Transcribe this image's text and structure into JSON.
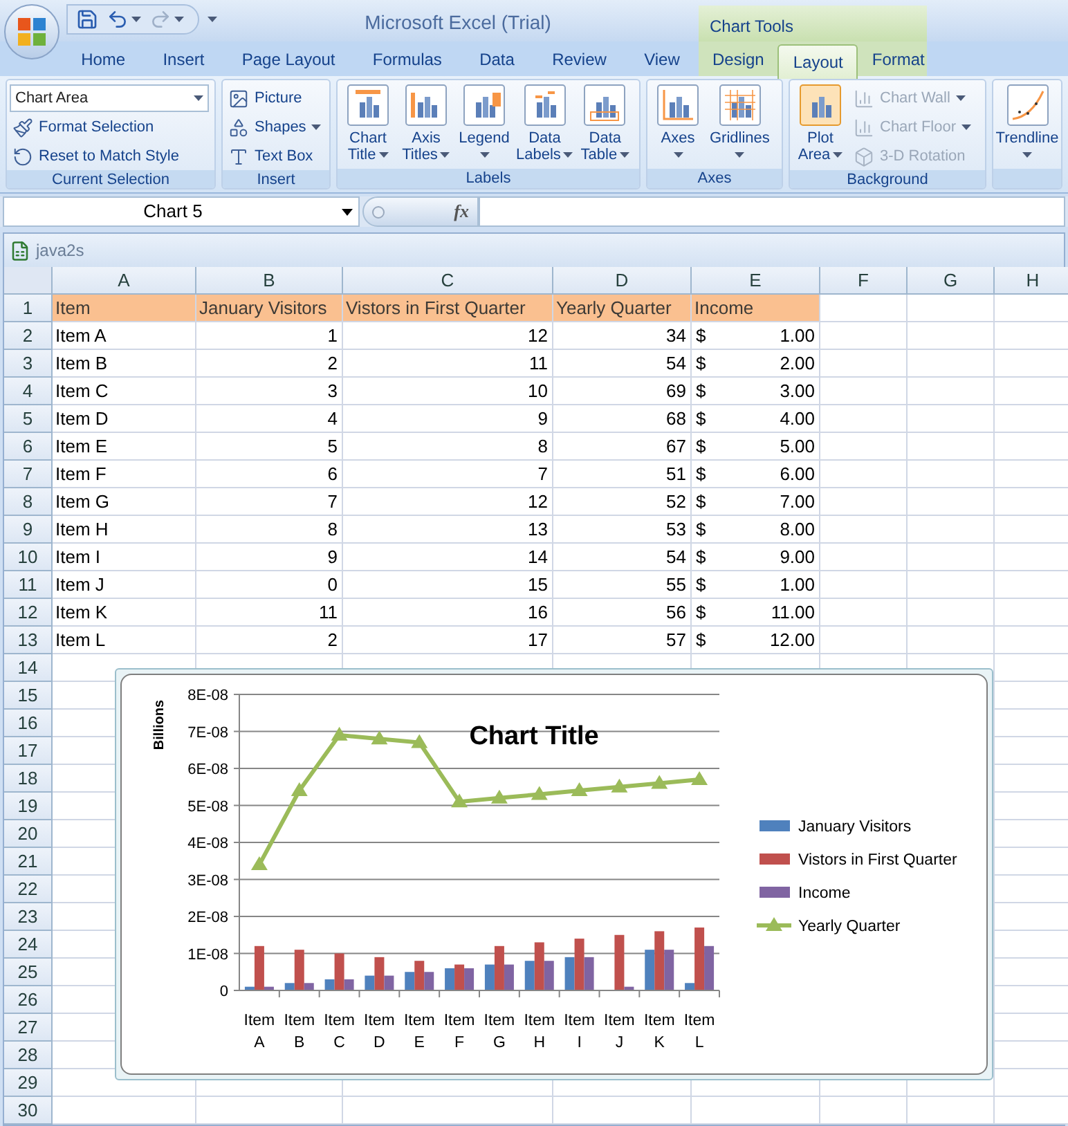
{
  "title_bar": {
    "title": "Microsoft Excel (Trial)",
    "contextual_group": "Chart Tools"
  },
  "quick_access": [
    {
      "kind": "save",
      "disabled": false
    },
    {
      "kind": "undo",
      "disabled": false
    },
    {
      "kind": "redo",
      "disabled": true
    }
  ],
  "tabs": [
    {
      "label": "Home",
      "selected": false,
      "contextual": false
    },
    {
      "label": "Insert",
      "selected": false,
      "contextual": false
    },
    {
      "label": "Page Layout",
      "selected": false,
      "contextual": false
    },
    {
      "label": "Formulas",
      "selected": false,
      "contextual": false
    },
    {
      "label": "Data",
      "selected": false,
      "contextual": false
    },
    {
      "label": "Review",
      "selected": false,
      "contextual": false
    },
    {
      "label": "View",
      "selected": false,
      "contextual": false
    },
    {
      "label": "Design",
      "selected": false,
      "contextual": true
    },
    {
      "label": "Layout",
      "selected": true,
      "contextual": true
    },
    {
      "label": "Format",
      "selected": false,
      "contextual": true
    }
  ],
  "ribbon_groups": [
    {
      "label": "Current Selection",
      "dropdown": "Chart Area",
      "small": [
        {
          "kind": "format",
          "label": "Format Selection",
          "menu": false,
          "disabled": false
        },
        {
          "kind": "reset",
          "label": "Reset to Match Style",
          "menu": false,
          "disabled": false
        }
      ]
    },
    {
      "label": "Insert",
      "small": [
        {
          "kind": "picture",
          "label": "Picture",
          "menu": false,
          "disabled": false
        },
        {
          "kind": "shapes",
          "label": "Shapes",
          "menu": true,
          "disabled": false
        },
        {
          "kind": "text_box",
          "label": "Text Box",
          "menu": false,
          "disabled": false
        }
      ]
    },
    {
      "label": "Labels",
      "large": [
        {
          "kind": "chart_title",
          "lines": [
            "Chart",
            "Title"
          ],
          "menu": true
        },
        {
          "kind": "axis_titles",
          "lines": [
            "Axis",
            "Titles"
          ],
          "menu": true
        },
        {
          "kind": "legend",
          "lines": [
            "Legend"
          ],
          "menu": true
        },
        {
          "kind": "data_labels",
          "lines": [
            "Data",
            "Labels"
          ],
          "menu": true
        },
        {
          "kind": "data_table",
          "lines": [
            "Data",
            "Table"
          ],
          "menu": true
        }
      ]
    },
    {
      "label": "Axes",
      "large": [
        {
          "kind": "axes",
          "lines": [
            "Axes"
          ],
          "menu": true
        },
        {
          "kind": "gridlines",
          "lines": [
            "Gridlines"
          ],
          "menu": true
        }
      ]
    },
    {
      "label": "Background",
      "large": [
        {
          "kind": "plot_area",
          "lines": [
            "Plot",
            "Area"
          ],
          "menu": true
        }
      ],
      "small": [
        {
          "kind": "chart_wall",
          "label": "Chart Wall",
          "menu": true,
          "disabled": true
        },
        {
          "kind": "chart_floor",
          "label": "Chart Floor",
          "menu": true,
          "disabled": true
        },
        {
          "kind": "rotation",
          "label": "3-D Rotation",
          "menu": false,
          "disabled": true
        }
      ]
    },
    {
      "large": [
        {
          "kind": "trendline",
          "lines": [
            "Trendline"
          ],
          "menu": true
        }
      ]
    }
  ],
  "name_box": "Chart 5",
  "formula_bar": {
    "function_label": "fx"
  },
  "workbook": {
    "title": "java2s"
  },
  "sheet": {
    "columns": [
      "A",
      "B",
      "C",
      "D",
      "E",
      "F",
      "G",
      "H"
    ],
    "header_row": {
      "number": "1",
      "cells": [
        "Item",
        "January Visitors",
        "Vistors in First Quarter",
        "Yearly Quarter",
        "Income"
      ]
    },
    "rows": [
      {
        "number": "2",
        "item": "Item A",
        "january_visitors": "1",
        "first_quarter": "12",
        "yearly_quarter": "34",
        "currency": "$",
        "income": "1.00"
      },
      {
        "number": "3",
        "item": "Item B",
        "january_visitors": "2",
        "first_quarter": "11",
        "yearly_quarter": "54",
        "currency": "$",
        "income": "2.00"
      },
      {
        "number": "4",
        "item": "Item C",
        "january_visitors": "3",
        "first_quarter": "10",
        "yearly_quarter": "69",
        "currency": "$",
        "income": "3.00"
      },
      {
        "number": "5",
        "item": "Item D",
        "january_visitors": "4",
        "first_quarter": "9",
        "yearly_quarter": "68",
        "currency": "$",
        "income": "4.00"
      },
      {
        "number": "6",
        "item": "Item E",
        "january_visitors": "5",
        "first_quarter": "8",
        "yearly_quarter": "67",
        "currency": "$",
        "income": "5.00"
      },
      {
        "number": "7",
        "item": "Item F",
        "january_visitors": "6",
        "first_quarter": "7",
        "yearly_quarter": "51",
        "currency": "$",
        "income": "6.00"
      },
      {
        "number": "8",
        "item": "Item G",
        "january_visitors": "7",
        "first_quarter": "12",
        "yearly_quarter": "52",
        "currency": "$",
        "income": "7.00"
      },
      {
        "number": "9",
        "item": "Item H",
        "january_visitors": "8",
        "first_quarter": "13",
        "yearly_quarter": "53",
        "currency": "$",
        "income": "8.00"
      },
      {
        "number": "10",
        "item": "Item I",
        "january_visitors": "9",
        "first_quarter": "14",
        "yearly_quarter": "54",
        "currency": "$",
        "income": "9.00"
      },
      {
        "number": "11",
        "item": "Item J",
        "january_visitors": "0",
        "first_quarter": "15",
        "yearly_quarter": "55",
        "currency": "$",
        "income": "1.00"
      },
      {
        "number": "12",
        "item": "Item K",
        "january_visitors": "11",
        "first_quarter": "16",
        "yearly_quarter": "56",
        "currency": "$",
        "income": "11.00"
      },
      {
        "number": "13",
        "item": "Item L",
        "january_visitors": "2",
        "first_quarter": "17",
        "yearly_quarter": "57",
        "currency": "$",
        "income": "12.00"
      }
    ],
    "empty_rows": [
      "14",
      "15",
      "16",
      "17",
      "18",
      "19",
      "20",
      "21",
      "22",
      "23",
      "24",
      "25",
      "26",
      "27",
      "28",
      "29",
      "30"
    ]
  },
  "chart": {
    "chart_data": {
      "type": "bar",
      "title": "Chart Title",
      "ylabel": "Billions",
      "categories": [
        "Item A",
        "Item B",
        "Item C",
        "Item D",
        "Item E",
        "Item F",
        "Item G",
        "Item H",
        "Item I",
        "Item J",
        "Item K",
        "Item L"
      ],
      "series": [
        {
          "name": "January Visitors",
          "color": "#4f81bd",
          "type": "bar",
          "values": [
            1e-09,
            2e-09,
            3e-09,
            4e-09,
            5e-09,
            6e-09,
            7e-09,
            8e-09,
            9e-09,
            0,
            1.1e-08,
            2e-09
          ]
        },
        {
          "name": "Vistors in First Quarter",
          "color": "#c0504d",
          "type": "bar",
          "values": [
            1.2e-08,
            1.1e-08,
            1e-08,
            9e-09,
            8e-09,
            7e-09,
            1.2e-08,
            1.3e-08,
            1.4e-08,
            1.5e-08,
            1.6e-08,
            1.7e-08
          ]
        },
        {
          "name": "Income",
          "color": "#8064a2",
          "type": "bar",
          "values": [
            1e-09,
            2e-09,
            3e-09,
            4e-09,
            5e-09,
            6e-09,
            7e-09,
            8e-09,
            9e-09,
            1e-09,
            1.1e-08,
            1.2e-08
          ]
        },
        {
          "name": "Yearly Quarter",
          "color": "#9bbb59",
          "type": "line",
          "marker": "triangle",
          "values": [
            3.4e-08,
            5.4e-08,
            6.9e-08,
            6.8e-08,
            6.7e-08,
            5.1e-08,
            5.2e-08,
            5.3e-08,
            5.4e-08,
            5.5e-08,
            5.6e-08,
            5.7e-08
          ]
        }
      ],
      "ylim": [
        0,
        8e-08
      ],
      "grid": true,
      "legend": true,
      "yticks": [
        {
          "value": 0,
          "label": "0"
        },
        {
          "value": 1e-08,
          "label": "1E-08"
        },
        {
          "value": 2e-08,
          "label": "2E-08"
        },
        {
          "value": 3e-08,
          "label": "3E-08"
        },
        {
          "value": 4e-08,
          "label": "4E-08"
        },
        {
          "value": 5e-08,
          "label": "5E-08"
        },
        {
          "value": 6e-08,
          "label": "6E-08"
        },
        {
          "value": 7e-08,
          "label": "7E-08"
        },
        {
          "value": 8e-08,
          "label": "8E-08"
        }
      ]
    }
  }
}
